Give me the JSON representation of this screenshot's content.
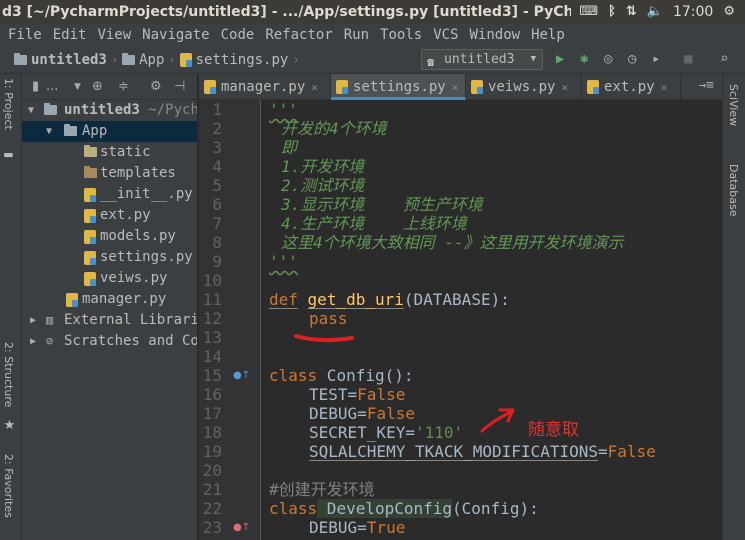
{
  "window": {
    "title": "d3 [~/PycharmProjects/untitled3] - .../App/settings.py [untitled3] - PyCharm",
    "clock": "17:00"
  },
  "menu": [
    "File",
    "Edit",
    "View",
    "Navigate",
    "Code",
    "Refactor",
    "Run",
    "Tools",
    "VCS",
    "Window",
    "Help"
  ],
  "breadcrumb": {
    "project": "untitled3",
    "folder": "App",
    "file": "settings.py"
  },
  "run_config": "untitled3",
  "left_tabs": [
    "1: Project",
    "2: Structure",
    "2: Favorites"
  ],
  "project_panel": {
    "toolbar_label": "..."
  },
  "tree": [
    {
      "label": "untitled3",
      "extra": "~/Pych",
      "type": "root"
    },
    {
      "label": "App",
      "type": "folder",
      "selected": true
    },
    {
      "label": "static",
      "type": "folder"
    },
    {
      "label": "templates",
      "type": "folder"
    },
    {
      "label": "__init__.py",
      "type": "py"
    },
    {
      "label": "ext.py",
      "type": "py"
    },
    {
      "label": "models.py",
      "type": "py"
    },
    {
      "label": "settings.py",
      "type": "py"
    },
    {
      "label": "veiws.py",
      "type": "py"
    },
    {
      "label": "manager.py",
      "type": "py"
    },
    {
      "label": "External Libraries",
      "type": "lib"
    },
    {
      "label": "Scratches and Cor",
      "type": "scratch"
    }
  ],
  "tabs": [
    {
      "label": "manager.py",
      "active": false
    },
    {
      "label": "settings.py",
      "active": true
    },
    {
      "label": "veiws.py",
      "active": false
    },
    {
      "label": "ext.py",
      "active": false
    }
  ],
  "tab_overflow": "→≡",
  "right_tabs": [
    "SciView",
    "Database"
  ],
  "line_numbers": [
    "1",
    "2",
    "3",
    "4",
    "5",
    "6",
    "7",
    "8",
    "9",
    "10",
    "11",
    "12",
    "13",
    "14",
    "15",
    "16",
    "17",
    "18",
    "19",
    "20",
    "21",
    "22",
    "23"
  ],
  "code": {
    "l1": "'''",
    "l2": "开发的4个环境",
    "l3": "即",
    "l4": "1.开发环境",
    "l5": "2.测试环境",
    "l6": "3.显示环境    预生产环境",
    "l7": "4.生产环境    上线环境",
    "l8": "这里4个环境大致相同 --》这里用开发环境演示",
    "l9": "'''",
    "l11_def": "def",
    "l11_name": "get_db_uri",
    "l11_open": "(",
    "l11_param": "DATABASE",
    "l11_close": "):",
    "l12": "pass",
    "l15_kw": "class",
    "l15_name": " Config():",
    "l16_key": "TEST",
    "l16_val": "False",
    "l17_key": "DEBUG",
    "l17_val": "False",
    "l18_key": "SECRET_KEY",
    "l18_val": "'110'",
    "l19_key": "SQLALCHEMY_TKACK_MODIFICATIONS",
    "l19_val": "False",
    "l21": "#创建开发环境",
    "l22_kw": "class",
    "l22_name": " DevelopConfig",
    "l22_rest": "(Config):",
    "l23_key": "DEBUG",
    "l23_val": "True"
  },
  "annotation": {
    "text": "随意取",
    "color": "#e53030"
  }
}
